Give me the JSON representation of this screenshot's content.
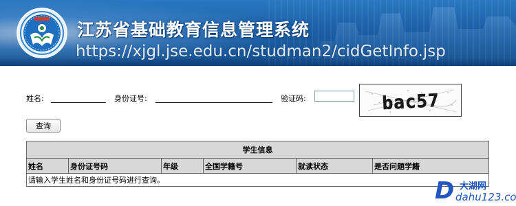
{
  "banner": {
    "title": "江苏省基础教育信息管理系统",
    "url": "https://xjgl.jse.edu.cn/studman2/cidGetInfo.jsp"
  },
  "form": {
    "name_label": "姓名:",
    "id_label": "身份证号:",
    "captcha_label": "验证码:",
    "captcha_input_value": "",
    "captcha_text": "bac57",
    "query_button": "查询"
  },
  "table": {
    "caption": "学生信息",
    "columns": [
      "姓名",
      "身份证号码",
      "年级",
      "全国学籍号",
      "就读状态",
      "是否问题学籍"
    ],
    "message": "请输入学生姓名和身份证号码进行查询。"
  },
  "watermark": {
    "letter": "D",
    "name": "大湖网",
    "domain": "dahu123.com"
  },
  "colors": {
    "banner_primary": "#1c5fa6",
    "header_bg": "#d8d8d8",
    "watermark": "#1f56c0"
  },
  "icons": {
    "logo": "education-emblem-icon"
  }
}
